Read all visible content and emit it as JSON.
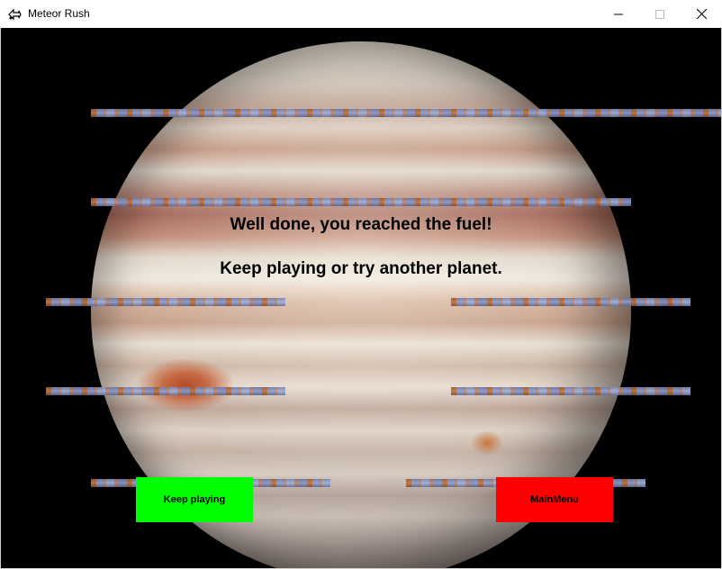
{
  "window": {
    "title": "Meteor Rush",
    "minimize_icon": "minimize-icon",
    "maximize_icon": "maximize-icon",
    "close_icon": "close-icon"
  },
  "game": {
    "message_line1": "Well done, you reached the fuel!",
    "message_line2": "Keep playing or try another planet.",
    "keep_playing_button": {
      "label": "Keep playing",
      "color": "#00ff00"
    },
    "main_menu_button": {
      "label": "MainMenu",
      "color": "#ff0000"
    },
    "background": "planet-jupiter-image",
    "platform_count": 8
  }
}
